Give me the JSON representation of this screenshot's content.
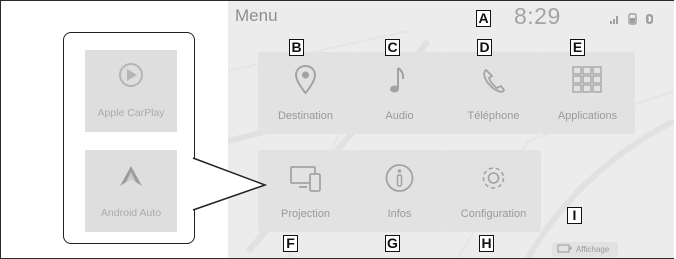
{
  "callout": {
    "tiles": [
      {
        "label": "Apple CarPlay",
        "icon": "play-circle-icon"
      },
      {
        "label": "Android Auto",
        "icon": "android-auto-icon"
      }
    ]
  },
  "screen": {
    "title": "Menu",
    "clock": "8:29",
    "status_icons": [
      "signal-icon",
      "phone-lock-icon",
      "bluetooth-icon"
    ],
    "tiles": [
      {
        "label": "Destination",
        "icon": "map-pin-icon"
      },
      {
        "label": "Audio",
        "icon": "music-note-icon"
      },
      {
        "label": "Téléphone",
        "icon": "phone-icon"
      },
      {
        "label": "Applications",
        "icon": "grid-icon"
      },
      {
        "label": "Projection",
        "icon": "devices-icon"
      },
      {
        "label": "Infos",
        "icon": "info-icon"
      },
      {
        "label": "Configuration",
        "icon": "gear-icon"
      }
    ],
    "affichage_label": "Affichage"
  },
  "markers": [
    "A",
    "B",
    "C",
    "D",
    "E",
    "F",
    "G",
    "H",
    "I"
  ]
}
